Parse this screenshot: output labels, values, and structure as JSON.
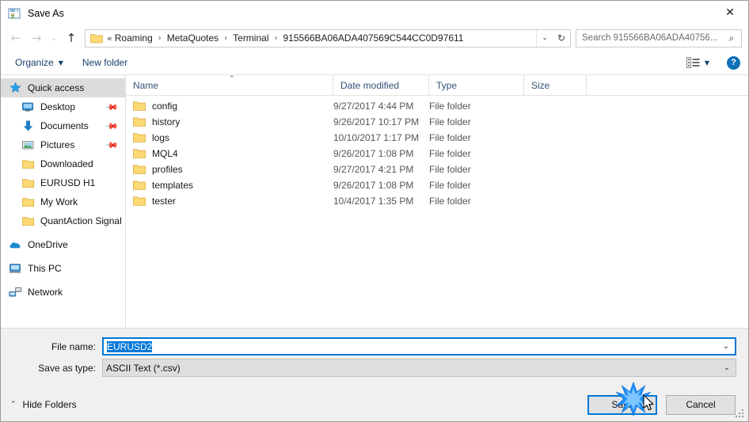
{
  "window": {
    "title": "Save As",
    "icon": "save-as-icon",
    "close_label": "✕"
  },
  "nav": {
    "back_icon": "arrow-left-icon",
    "forward_icon": "arrow-right-icon",
    "recent_icon": "chevron-down-icon",
    "up_icon": "arrow-up-icon",
    "back_glyph": "←",
    "forward_glyph": "→",
    "recent_glyph": "⌄",
    "up_glyph": "↑"
  },
  "address": {
    "folder_icon": "folder-icon",
    "prefix": "«",
    "crumbs": [
      "Roaming",
      "MetaQuotes",
      "Terminal",
      "915566BA06ADA407569C544CC0D97611"
    ],
    "separator": "›",
    "dropdown_glyph": "⌄",
    "refresh_glyph": "↻"
  },
  "search": {
    "placeholder": "Search 915566BA06ADA40756...",
    "icon": "search-icon",
    "icon_glyph": "⌕"
  },
  "toolbar": {
    "organize_label": "Organize",
    "organize_caret": "▼",
    "new_folder_label": "New folder",
    "view_icon": "view-layout-icon",
    "view_caret": "▼",
    "help_icon": "help-icon",
    "help_label": "?"
  },
  "sidebar": {
    "items": [
      {
        "label": "Quick access",
        "icon": "star-icon",
        "indent": false,
        "selected": true,
        "pinned": false
      },
      {
        "label": "Desktop",
        "icon": "monitor-icon",
        "indent": true,
        "selected": false,
        "pinned": true
      },
      {
        "label": "Documents",
        "icon": "download-icon",
        "indent": true,
        "selected": false,
        "pinned": true
      },
      {
        "label": "Pictures",
        "icon": "picture-icon",
        "indent": true,
        "selected": false,
        "pinned": true
      },
      {
        "label": "Downloaded",
        "icon": "folder-icon",
        "indent": true,
        "selected": false,
        "pinned": false
      },
      {
        "label": "EURUSD H1",
        "icon": "folder-icon",
        "indent": true,
        "selected": false,
        "pinned": false
      },
      {
        "label": "My Work",
        "icon": "folder-icon",
        "indent": true,
        "selected": false,
        "pinned": false
      },
      {
        "label": "QuantAction Signal",
        "icon": "folder-icon",
        "indent": true,
        "selected": false,
        "pinned": false
      },
      {
        "label": "OneDrive",
        "icon": "cloud-icon",
        "indent": false,
        "selected": false,
        "pinned": false,
        "group": true
      },
      {
        "label": "This PC",
        "icon": "computer-icon",
        "indent": false,
        "selected": false,
        "pinned": false,
        "group": true
      },
      {
        "label": "Network",
        "icon": "network-icon",
        "indent": false,
        "selected": false,
        "pinned": false,
        "group": true
      }
    ]
  },
  "filelist": {
    "columns": [
      "Name",
      "Date modified",
      "Type",
      "Size"
    ],
    "sort_caret": "⌃",
    "rows": [
      {
        "name": "config",
        "date": "9/27/2017 4:44 PM",
        "type": "File folder",
        "size": ""
      },
      {
        "name": "history",
        "date": "9/26/2017 10:17 PM",
        "type": "File folder",
        "size": ""
      },
      {
        "name": "logs",
        "date": "10/10/2017 1:17 PM",
        "type": "File folder",
        "size": ""
      },
      {
        "name": "MQL4",
        "date": "9/26/2017 1:08 PM",
        "type": "File folder",
        "size": ""
      },
      {
        "name": "profiles",
        "date": "9/27/2017 4:21 PM",
        "type": "File folder",
        "size": ""
      },
      {
        "name": "templates",
        "date": "9/26/2017 1:08 PM",
        "type": "File folder",
        "size": ""
      },
      {
        "name": "tester",
        "date": "10/4/2017 1:35 PM",
        "type": "File folder",
        "size": ""
      }
    ]
  },
  "form": {
    "filename_label": "File name:",
    "filename_value": "EURUSD2",
    "filetype_label": "Save as type:",
    "filetype_value": "ASCII Text (*.csv)",
    "dropdown_glyph": "⌄"
  },
  "footer": {
    "hide_folders_label": "Hide Folders",
    "hide_folders_caret": "⌃",
    "save_label": "Save",
    "cancel_label": "Cancel"
  },
  "colors": {
    "accent": "#0078d7",
    "selection": "#0078d7",
    "column_header_text": "#33527a",
    "toolbar_link": "#19406c",
    "folder_yellow": "#fcd975",
    "burst_blue": "#1e90ff"
  }
}
